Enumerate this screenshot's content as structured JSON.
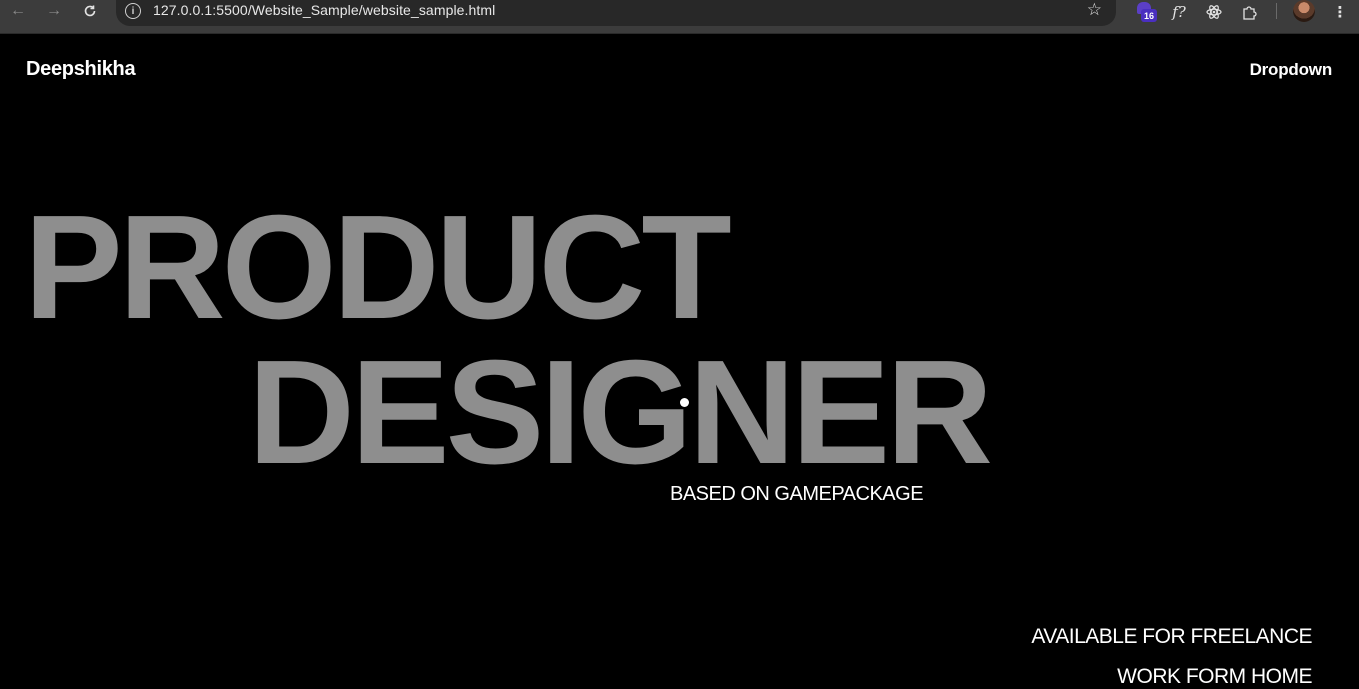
{
  "browser": {
    "url": "127.0.0.1:5500/Website_Sample/website_sample.html",
    "extension_badge": "16",
    "icons": {
      "back": "arrow-left-icon",
      "forward": "arrow-right-icon",
      "reload": "reload-icon",
      "info": "info-icon",
      "bookmark": "star-icon",
      "fx": "function-icon",
      "react": "react-icon",
      "extensions": "puzzle-icon",
      "menu": "kebab-menu-icon"
    }
  },
  "site": {
    "brand": "Deepshikha",
    "nav_dropdown": "Dropdown",
    "hero_line1": "PRODUCT",
    "hero_line2": "DESIGNER",
    "based_on": "BASED ON GAMEPACKAGE",
    "available": "AVAILABLE FOR FREELANCE",
    "work_from_home": "WORK FORM HOME"
  },
  "colors": {
    "background": "#000000",
    "hero_text": "#8e8e8e",
    "text": "#ffffff",
    "chrome": "#3c3c3c"
  }
}
